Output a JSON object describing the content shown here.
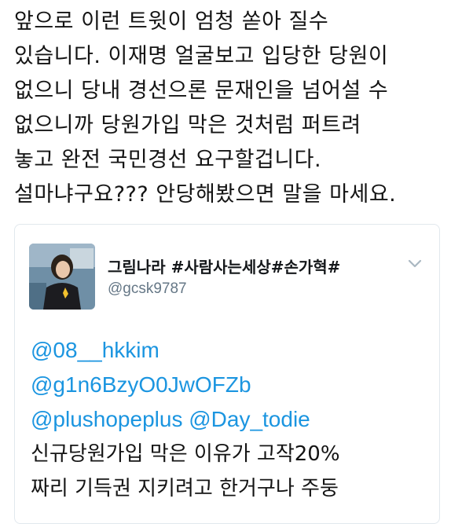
{
  "tweet": {
    "lines": [
      "앞으로 이런 트윗이 엄청 쏟아 질수",
      "있습니다. 이재명 얼굴보고 입당한 당원이",
      "없으니 당내 경선으론 문재인을 넘어설 수",
      "없으니까 당원가입 막은 것처럼 퍼트려",
      "놓고 완전 국민경선 요구할겁니다.",
      "설마냐구요??? 안당해봤으면 말을 마세요."
    ]
  },
  "quoted": {
    "display_name": "그림나라 #사람사는세상#손가혁#",
    "handle": "@gcsk9787",
    "mentions": {
      "m1": "@08__hkkim",
      "m2": "@g1n6BzyO0JwOFZb",
      "m3": "@plushopeplus",
      "m4": "@Day_todie"
    },
    "body_lines": [
      "신규당원가입 막은  이유가 고작20%",
      "짜리 기득권 지키려고 한거구나  주둥"
    ],
    "menu_icon": "chevron-down-icon"
  },
  "colors": {
    "mention": "#1b95e0",
    "border": "#e1e8ed",
    "handle": "#657786"
  }
}
